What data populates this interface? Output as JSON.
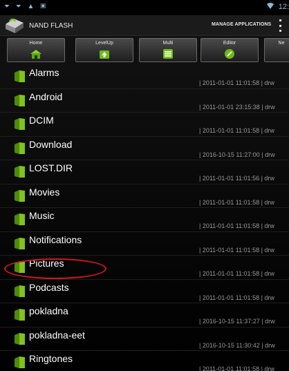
{
  "status_bar": {
    "left_icons": "⏷ ⏷ ▲ ▣",
    "wifi_icon": "wifi-icon",
    "time": "12:"
  },
  "action_bar": {
    "title": "NAND FLASH",
    "manage_label": "MANAGE APPLICATIONS"
  },
  "toolbar": {
    "buttons": [
      {
        "label": "Home"
      },
      {
        "label": "LevelUp"
      },
      {
        "label": "Multi"
      },
      {
        "label": "Editor"
      },
      {
        "label": "Ne"
      }
    ]
  },
  "files": [
    {
      "name": "Alarms",
      "meta": "| 2011-01-01 11:01:58 | drw"
    },
    {
      "name": "Android",
      "meta": "| 2011-01-01 23:15:38 | drw"
    },
    {
      "name": "DCIM",
      "meta": "| 2011-01-01 11:01:58 | drw"
    },
    {
      "name": "Download",
      "meta": "| 2016-10-15 11:27:00 | drw"
    },
    {
      "name": "LOST.DIR",
      "meta": "| 2011-01-01 11:01:56 | drw"
    },
    {
      "name": "Movies",
      "meta": "| 2011-01-01 11:01:58 | drw"
    },
    {
      "name": "Music",
      "meta": "| 2011-01-01 11:01:58 | drw"
    },
    {
      "name": "Notifications",
      "meta": "| 2011-01-01 11:01:58 | drw"
    },
    {
      "name": "Pictures",
      "meta": "| 2011-01-01 11:01:58 | drw"
    },
    {
      "name": "Podcasts",
      "meta": "| 2011-01-01 11:01:58 | drw"
    },
    {
      "name": "pokladna",
      "meta": "| 2016-10-15 11:37:27 | drw"
    },
    {
      "name": "pokladna-eet",
      "meta": "| 2016-10-15 11:30:42 | drw"
    },
    {
      "name": "Ringtones",
      "meta": "| 2011-01-01 11:01:58 | drw"
    }
  ],
  "colors": {
    "folder_green": "#7fc31c",
    "highlight_red": "#d8151c",
    "status_blue": "#8fb7d6"
  }
}
